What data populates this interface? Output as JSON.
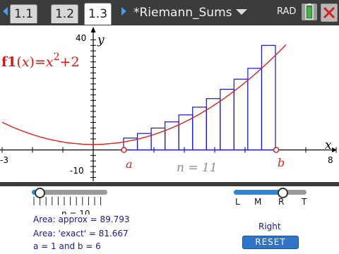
{
  "tabbar": {
    "tabs": [
      {
        "label": "1.1",
        "active": false
      },
      {
        "label": "1.2",
        "active": false
      },
      {
        "label": "1.3",
        "active": true
      }
    ],
    "doc_title": "*Riemann_Sums",
    "angle_mode": "RAD"
  },
  "graph": {
    "function_name": "f1",
    "function_var": "x",
    "function_expr": "=x",
    "function_exp": "2",
    "function_tail": "+2",
    "x_min_label": "-3",
    "x_max_label": "8",
    "y_max_label": "40",
    "y_min_label": "-10",
    "x_axis_label": "x",
    "y_axis_label": "y",
    "a_label": "a",
    "b_label": "b",
    "n_text": "n = 11",
    "curve_color": "#e0201a",
    "rect_color": "#1414d6"
  },
  "chart_data": {
    "type": "bar",
    "function": "x^2+2",
    "x_range": [
      -3,
      8
    ],
    "y_range": [
      -10,
      40
    ],
    "a": 1,
    "b": 6,
    "n": 11,
    "rule": "right",
    "rect_heights": [
      4.3,
      5.98,
      7.95,
      10.2,
      12.74,
      15.55,
      18.66,
      22.05,
      25.72,
      29.67,
      38
    ]
  },
  "controls": {
    "n_slider_label": "n = 10",
    "area_approx": "Area: approx = 89.793",
    "area_exact": "Area: 'exact' = 81.667",
    "ab_text": "a = 1 and b = 6",
    "rule_name": "Right",
    "reset_label": "RESET",
    "rule_options": [
      "L",
      "M",
      "R",
      "T"
    ],
    "n_slider_value_fraction": 0.1,
    "rule_slider_selected": "R"
  }
}
